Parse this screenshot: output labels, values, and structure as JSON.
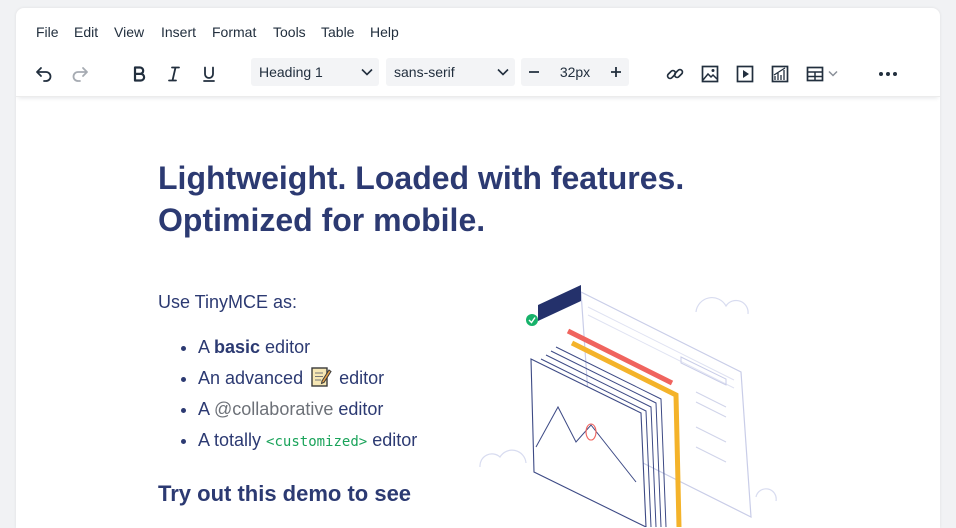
{
  "menubar": {
    "items": [
      "File",
      "Edit",
      "View",
      "Insert",
      "Format",
      "Tools",
      "Table",
      "Help"
    ]
  },
  "toolbar": {
    "block_format": "Heading 1",
    "font_family": "sans-serif",
    "font_size": "32px"
  },
  "content": {
    "heading": "Lightweight. Loaded with features. Optimized for mobile.",
    "intro": "Use TinyMCE as:",
    "list": {
      "item1_prefix": "A ",
      "item1_bold": "basic",
      "item1_suffix": " editor",
      "item2_prefix": "An advanced ",
      "item2_suffix": " editor",
      "item3_prefix": "A ",
      "item3_mention": "@collaborative",
      "item3_suffix": " editor",
      "item4_prefix": "A totally ",
      "item4_code": "<customized>",
      "item4_suffix": " editor"
    },
    "subheading": "Try out this demo to see"
  },
  "colors": {
    "text": "#222f3e",
    "heading": "#2c3a72",
    "code": "#1aa35a",
    "accent_orange": "#f4a72a",
    "accent_red": "#f0645e"
  }
}
